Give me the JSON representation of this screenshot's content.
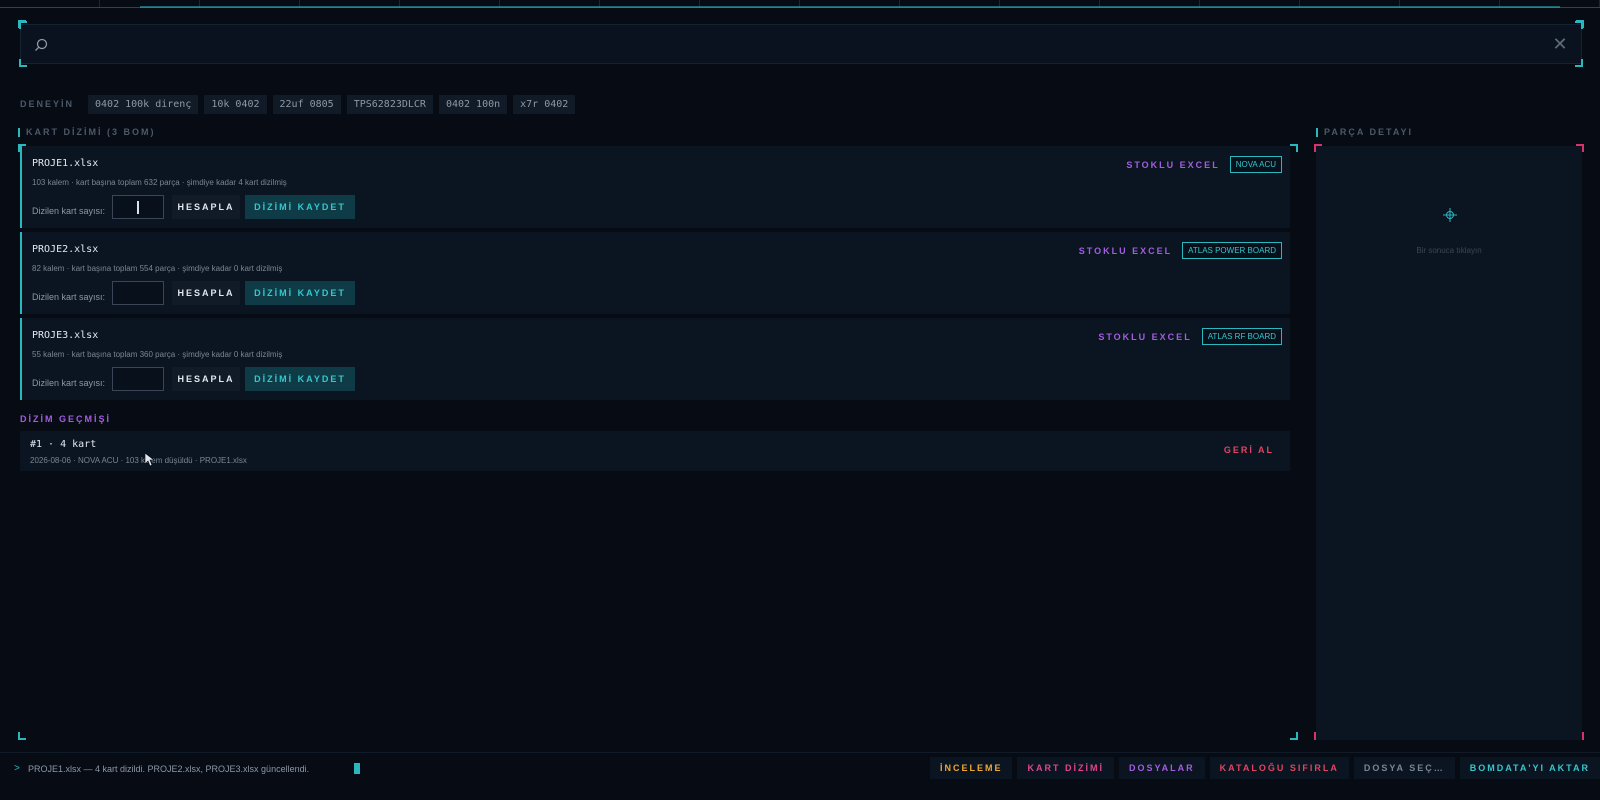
{
  "search": {
    "value": "",
    "placeholder": ""
  },
  "try": {
    "label": "DENEYİN",
    "chips": [
      "0402 100k direnç",
      "10k 0402",
      "22uf 0805",
      "TPS62823DLCR",
      "0402 100n",
      "x7r 0402"
    ]
  },
  "board_section": {
    "title": "KART DİZİMİ  (3 BOM)"
  },
  "detail_section": {
    "title": "PARÇA DETAYI",
    "placeholder": "Bir sonuca tıklayın"
  },
  "boms": [
    {
      "file": "PROJE1.xlsx",
      "meta": "103 kalem · kart başına toplam 632 parça · şimdiye kadar 4 kart dizilmiş",
      "count_label": "Dizilen kart sayısı:",
      "count_value": "",
      "stock_label": "STOKLU EXCEL",
      "board": "NOVA ACU",
      "calc_label": "HESAPLA",
      "save_label": "DİZİMİ KAYDET"
    },
    {
      "file": "PROJE2.xlsx",
      "meta": "82 kalem · kart başına toplam 554 parça · şimdiye kadar 0 kart dizilmiş",
      "count_label": "Dizilen kart sayısı:",
      "count_value": "",
      "stock_label": "STOKLU EXCEL",
      "board": "ATLAS POWER BOARD",
      "calc_label": "HESAPLA",
      "save_label": "DİZİMİ KAYDET"
    },
    {
      "file": "PROJE3.xlsx",
      "meta": "55 kalem · kart başına toplam 360 parça · şimdiye kadar 0 kart dizilmiş",
      "count_label": "Dizilen kart sayısı:",
      "count_value": "",
      "stock_label": "STOKLU EXCEL",
      "board": "ATLAS RF BOARD",
      "calc_label": "HESAPLA",
      "save_label": "DİZİMİ KAYDET"
    }
  ],
  "history": {
    "title": "DİZİM GEÇMİŞİ",
    "items": [
      {
        "main": "#1  ·  4 kart",
        "meta": "2026-08-06  ·  NOVA ACU  ·  103 kalem düşüldü  ·  PROJE1.xlsx",
        "undo_label": "GERİ AL"
      }
    ]
  },
  "status": {
    "prompt": ">",
    "message": "PROJE1.xlsx — 4 kart dizildi. PROJE2.xlsx, PROJE3.xlsx güncellendi."
  },
  "actions": [
    {
      "label": "İNCELEME",
      "color": "#f0a830"
    },
    {
      "label": "KART DİZİMİ",
      "color": "#e0458a"
    },
    {
      "label": "DOSYALAR",
      "color": "#a45de0"
    },
    {
      "label": "KATALOĞU SIFIRLA",
      "color": "#e0455f"
    },
    {
      "label": "DOSYA SEÇ…",
      "color": "#7a8594"
    },
    {
      "label": "BOMDATA'YI AKTAR",
      "color": "#36c7cc"
    }
  ],
  "colors": {
    "accent": "#2ab7bd",
    "purple": "#a45de0",
    "danger": "#e0455f",
    "background": "#060b14"
  }
}
